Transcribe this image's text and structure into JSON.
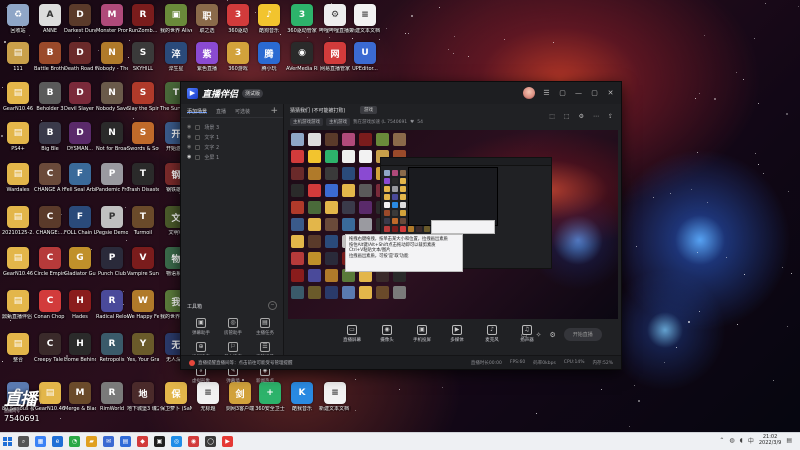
{
  "desktop": {
    "icons": [
      {
        "label": "回收站",
        "color": "#8fa6c7",
        "glyph": "♻"
      },
      {
        "label": "ANNE",
        "color": "#ddd",
        "glyph": "A"
      },
      {
        "label": "Darkest Dungeon®",
        "color": "#5a3a2a",
        "glyph": "D"
      },
      {
        "label": "Monster Prom",
        "color": "#b04a7a",
        "glyph": "M"
      },
      {
        "label": "RunZomb...",
        "color": "#7a1c1c",
        "glyph": "R"
      },
      {
        "label": "我的世界 Alive of...",
        "color": "#6a8a3a",
        "glyph": "▣"
      },
      {
        "label": "职之选",
        "color": "#8a6a4a",
        "glyph": "职"
      },
      {
        "label": "360驱动",
        "color": "#d23b3b",
        "glyph": "3"
      },
      {
        "label": "酷狗音乐",
        "color": "#f2c42e",
        "glyph": "♪"
      },
      {
        "label": "360驱动管家",
        "color": "#2db36b",
        "glyph": "3"
      },
      {
        "label": "哔哩哔哩直播姬",
        "color": "#eee",
        "glyph": "⚙"
      },
      {
        "label": "新建文本文档",
        "color": "#f2f2f2",
        "glyph": "≡"
      },
      {
        "label": "111",
        "color": "#c9a04a",
        "glyph": "▤"
      },
      {
        "label": "Battle Brothers",
        "color": "#9a4a2a",
        "glyph": "B"
      },
      {
        "label": "Death Road to Canada",
        "color": "#6a2a2a",
        "glyph": "D"
      },
      {
        "label": "Nobody - The Turna...",
        "color": "#b07a2a",
        "glyph": "N"
      },
      {
        "label": "SKYHILL",
        "color": "#3a3a3a",
        "glyph": "S"
      },
      {
        "label": "淬生星",
        "color": "#2a4a7a",
        "glyph": "淬"
      },
      {
        "label": "紫色直播",
        "color": "#8a4ad2",
        "glyph": "紫"
      },
      {
        "label": "360游戏",
        "color": "#d2a23b",
        "glyph": "3"
      },
      {
        "label": "腾小玩",
        "color": "#2a6ad2",
        "glyph": "腾"
      },
      {
        "label": "AVerMedia RECentral 4",
        "color": "#2a2a2a",
        "glyph": "◉"
      },
      {
        "label": "网易直播管家",
        "color": "#d23b3b",
        "glyph": "网"
      },
      {
        "label": "UPEditor...",
        "color": "#3b6ad2",
        "glyph": "U"
      },
      {
        "label": "GearN10.46",
        "color": "#e3b64a",
        "glyph": "▤"
      },
      {
        "label": "Beholder 3",
        "color": "#5a5a5a",
        "glyph": "B"
      },
      {
        "label": "Devil Slayer Raksasi",
        "color": "#7a2a3a",
        "glyph": "D"
      },
      {
        "label": "Nobody Saves the...",
        "color": "#6a5a4a",
        "glyph": "N"
      },
      {
        "label": "Slay the Spire",
        "color": "#b03a2a",
        "glyph": "S"
      },
      {
        "label": "The Survivalist",
        "color": "#4a6a3a",
        "glyph": "T"
      },
      {
        "label": "PS4+",
        "color": "#e3b64a",
        "glyph": "▤"
      },
      {
        "label": "Big Ble",
        "color": "#3a3a4a",
        "glyph": "B"
      },
      {
        "label": "DYSMAN...",
        "color": "#5a2a6a",
        "glyph": "D"
      },
      {
        "label": "Not for Broadcast",
        "color": "#2a2a2a",
        "glyph": "N"
      },
      {
        "label": "Swords & Souls Ne...",
        "color": "#c06a2a",
        "glyph": "S"
      },
      {
        "label": "开始游戏",
        "color": "#3a5a8a",
        "glyph": "开"
      },
      {
        "label": "Wardales",
        "color": "#e3b64a",
        "glyph": "▤"
      },
      {
        "label": "CHANGE A Homeless",
        "color": "#6a4a3a",
        "glyph": "C"
      },
      {
        "label": "Fell Seal Arbiter's Mark",
        "color": "#3a6a9a",
        "glyph": "F"
      },
      {
        "label": "Pandemic Frozen...",
        "color": "#9a9aa0",
        "glyph": "P"
      },
      {
        "label": "Trash Disaster",
        "color": "#2a2a2a",
        "glyph": "T"
      },
      {
        "label": "钢铁雄心",
        "color": "#7a2a2a",
        "glyph": "钢"
      },
      {
        "label": "20210125-2...",
        "color": "#e3b64a",
        "glyph": "▤"
      },
      {
        "label": "CHANGE:...",
        "color": "#5a3a2a",
        "glyph": "C"
      },
      {
        "label": "FOLL Chain Light",
        "color": "#2a4a7a",
        "glyph": "F"
      },
      {
        "label": "Pegsie Demon",
        "color": "#c0c0c0",
        "glyph": "P"
      },
      {
        "label": "Turmoil",
        "color": "#6a4a2a",
        "glyph": "T"
      },
      {
        "label": "文明VI",
        "color": "#4a5a2a",
        "glyph": "文"
      },
      {
        "label": "GearN10.46",
        "color": "#e3b64a",
        "glyph": "▤"
      },
      {
        "label": "Circle Empires",
        "color": "#b63a3a",
        "glyph": "C"
      },
      {
        "label": "Gladiator Guild Manager",
        "color": "#c0902a",
        "glyph": "G"
      },
      {
        "label": "Punch Club",
        "color": "#2a2a3a",
        "glyph": "P"
      },
      {
        "label": "Vampire Survivors",
        "color": "#7a1c1c",
        "glyph": "V"
      },
      {
        "label": "物语系列",
        "color": "#3a6a4a",
        "glyph": "物"
      },
      {
        "label": "鼎甄直播伴侣 素材库",
        "color": "#e3b64a",
        "glyph": "▤"
      },
      {
        "label": "Conan Chop Chop",
        "color": "#d23b3b",
        "glyph": "C"
      },
      {
        "label": "Hades",
        "color": "#8a1c1c",
        "glyph": "H"
      },
      {
        "label": "Radical Relocation",
        "color": "#4a4a9a",
        "glyph": "R"
      },
      {
        "label": "We Happy Few",
        "color": "#b07a2a",
        "glyph": "W"
      },
      {
        "label": "我的世界 地下城",
        "color": "#5a7a3a",
        "glyph": "我"
      },
      {
        "label": "整合",
        "color": "#e3b64a",
        "glyph": "▤"
      },
      {
        "label": "Creepy Tale 2",
        "color": "#3a2a2a",
        "glyph": "C"
      },
      {
        "label": "Home Behind 2",
        "color": "#2a2a2a",
        "glyph": "H"
      },
      {
        "label": "Retropolis",
        "color": "#3a5a6a",
        "glyph": "R"
      },
      {
        "label": "Yes, Your Grace",
        "color": "#6a5a2a",
        "glyph": "Y"
      },
      {
        "label": "无人深空",
        "color": "#2a3a6a",
        "glyph": "无"
      },
      {
        "label": "80 Serious 极速 Gaming",
        "color": "#5a7ab0",
        "glyph": "8"
      },
      {
        "label": "GearN10.46",
        "color": "#e3b64a",
        "glyph": "▤"
      },
      {
        "label": "Merge & Blade",
        "color": "#6a4a2a",
        "glyph": "M"
      },
      {
        "label": "RimWorld",
        "color": "#7a7a7a",
        "glyph": "R"
      },
      {
        "label": "地下城堡3 魂之诗",
        "color": "#4a2a2a",
        "glyph": "地"
      },
      {
        "label": "保卫萝卜 (SaNOMa...",
        "color": "#e3b64a",
        "glyph": "保"
      },
      {
        "label": "无标题",
        "color": "#f2f2f2",
        "glyph": "≡"
      },
      {
        "label": "剑网3客户端",
        "color": "#d2a23b",
        "glyph": "剑"
      },
      {
        "label": "360安全卫士",
        "color": "#2db36b",
        "glyph": "+"
      },
      {
        "label": "酷我音乐",
        "color": "#2a8ae2",
        "glyph": "K"
      },
      {
        "label": "新建文本文档 (3)",
        "color": "#f2f2f2",
        "glyph": "≡"
      }
    ]
  },
  "app": {
    "name": "直播伴侣",
    "version_badge": "测试版",
    "window_buttons": [
      "☰",
      "▢",
      "—",
      "▢",
      "✕"
    ],
    "left_tabs": [
      "添加场景",
      "直播",
      "可选装"
    ],
    "active_tab": 0,
    "scenes": [
      "场景 3",
      "文字 1",
      "文字 2",
      "全屏 1"
    ],
    "toolbox_label": "工具箱",
    "tools": [
      {
        "icon": "▣",
        "label": "弹幕助手"
      },
      {
        "icon": "◎",
        "label": "房管助手"
      },
      {
        "icon": "▤",
        "label": "主播任务"
      },
      {
        "icon": "⊕",
        "label": "投屏连麦"
      },
      {
        "icon": "⚐",
        "label": "单人连麦"
      },
      {
        "icon": "☰",
        "label": "竞猜榜单"
      },
      {
        "icon": "⇩",
        "label": "虚拟形象"
      },
      {
        "icon": "✎",
        "label": "弹幕墙"
      },
      {
        "icon": "◈",
        "label": "新闻热点"
      }
    ],
    "room_title": "猜猜我们 (不可能被打败)",
    "room_tag": "游戏",
    "chips": [
      "主机游戏游戏",
      "主机游戏"
    ],
    "room_meta": "我在游戏加速 (L 7540691",
    "fans_count": "54",
    "top_icons": [
      "⬚",
      "⬚",
      "⚙",
      "⋯",
      "⇪"
    ],
    "tooltip_lines": [
      "拖拽右键拖拽，按单击某大小和位置，拉拽画出素质",
      "按住Alt键/Alt+Shift点击拖动即可以裁剪素质",
      "Ctrl+V粘贴文本/图片",
      "拉拽画出素质，可按'是'取'功能"
    ],
    "bottom_tools": [
      {
        "icon": "▭",
        "label": "直播屏幕"
      },
      {
        "icon": "◉",
        "label": "摄像头"
      },
      {
        "icon": "▣",
        "label": "手机投屏"
      },
      {
        "icon": "▶",
        "label": "多媒体"
      },
      {
        "icon": "♪",
        "label": "麦克风"
      },
      {
        "icon": "♫",
        "label": "扬声器"
      }
    ],
    "live_button": "开始直播",
    "notice_text": "直播提醒直播间等：点击前往可能受号管理提醒",
    "stats": [
      "直播时长00:00",
      "FPS:60",
      "码率0kbps",
      "CPU:14%",
      "内存:52%"
    ]
  },
  "watermark": {
    "logo": "直播",
    "sub": "直播间号",
    "id": "7540691"
  },
  "taskbar": {
    "apps": [
      {
        "glyph": "⌕",
        "color": "#555"
      },
      {
        "glyph": "▦",
        "color": "#3b82f6"
      },
      {
        "glyph": "e",
        "color": "#1f6fd6"
      },
      {
        "glyph": "◔",
        "color": "#2aa845"
      },
      {
        "glyph": "▰",
        "color": "#e0a020"
      },
      {
        "glyph": "✉",
        "color": "#3b6ad2"
      },
      {
        "glyph": "▤",
        "color": "#2f6bd8"
      },
      {
        "glyph": "◆",
        "color": "#d23b3b"
      },
      {
        "glyph": "▣",
        "color": "#202020"
      },
      {
        "glyph": "◎",
        "color": "#1f8de8"
      },
      {
        "glyph": "◉",
        "color": "#d23b3b"
      },
      {
        "glyph": "◯",
        "color": "#3b3b3b"
      },
      {
        "glyph": "▶",
        "color": "#e53935"
      }
    ],
    "time": "21:02",
    "date": "2022/3/9"
  },
  "colors": {
    "accent": "#3c7cff",
    "window_bg": "#202124",
    "taskbar_bg": "#eef0f3"
  }
}
